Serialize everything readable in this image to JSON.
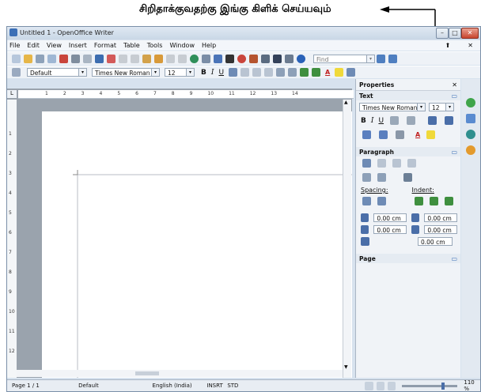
{
  "annotation": {
    "text": "சிறிதாக்குவதற்கு இங்கு கிளிக் செய்யவும்"
  },
  "window": {
    "title": "Untitled 1 - OpenOffice Writer"
  },
  "menu": [
    "File",
    "Edit",
    "View",
    "Insert",
    "Format",
    "Table",
    "Tools",
    "Window",
    "Help"
  ],
  "toolbar": {
    "find_placeholder": "Find"
  },
  "format": {
    "style": "Default",
    "font": "Times New Roman",
    "size": "12"
  },
  "sidebar": {
    "title": "Properties",
    "text_section": "Text",
    "font": "Times New Roman",
    "size": "12",
    "paragraph_section": "Paragraph",
    "spacing_label": "Spacing:",
    "indent_label": "Indent:",
    "spin_values": [
      "0.00 cm",
      "0.00 cm",
      "0.00 cm",
      "0.00 cm",
      "0.00 cm"
    ],
    "page_section": "Page"
  },
  "ruler_numbers": [
    "1",
    "2",
    "3",
    "4",
    "5",
    "6",
    "7",
    "8",
    "9",
    "10",
    "11",
    "12",
    "13",
    "14"
  ],
  "vruler_numbers": [
    "1",
    "2",
    "3",
    "4",
    "5",
    "6",
    "7",
    "8",
    "9",
    "10",
    "11",
    "12"
  ],
  "status": {
    "page": "Page 1 / 1",
    "style": "Default",
    "language": "English (India)",
    "insert": "INSRT",
    "select": "STD",
    "zoom": "110 %"
  },
  "colors": {
    "accent": "#3b6fb6",
    "titlebar": "#cfdbe8",
    "page_bg": "#9aa3ad"
  }
}
